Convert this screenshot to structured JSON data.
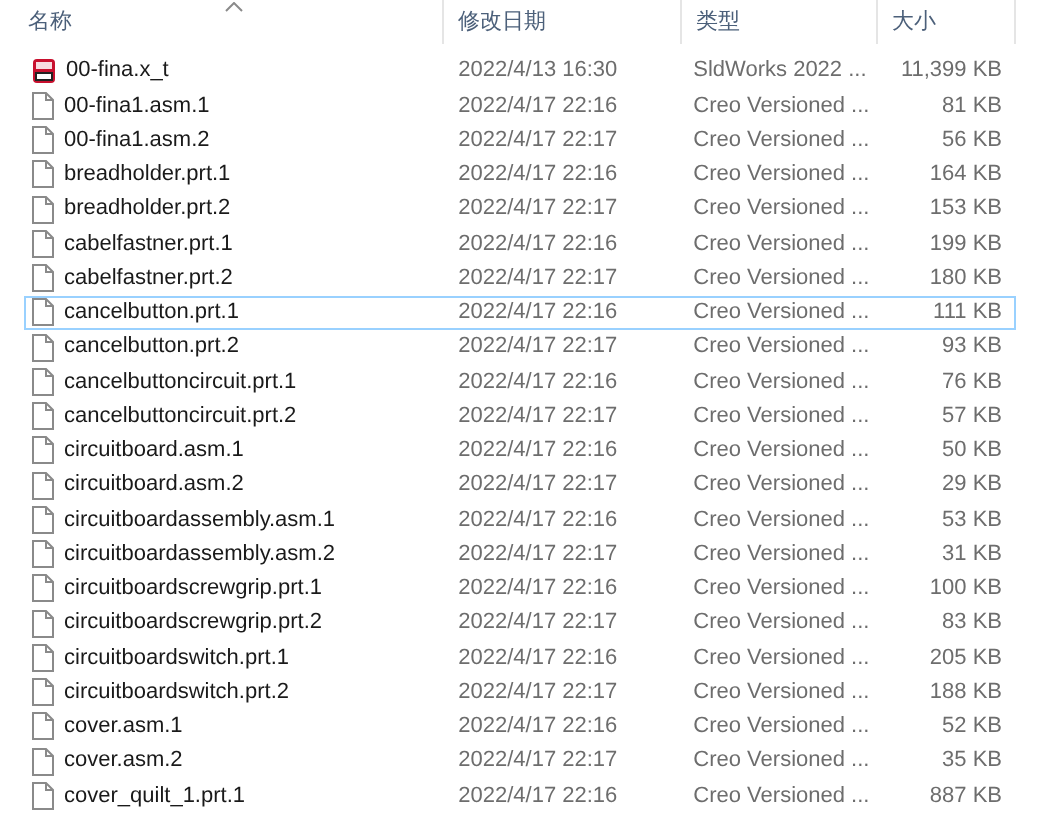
{
  "columns": [
    {
      "label": "名称",
      "sorted": true
    },
    {
      "label": "修改日期",
      "sorted": false
    },
    {
      "label": "类型",
      "sorted": false
    },
    {
      "label": "大小",
      "sorted": false
    }
  ],
  "rows": [
    {
      "kind": "solidworks",
      "name": "00-fina.x_t",
      "date": "2022/4/13 16:30",
      "type": "SldWorks 2022 ...",
      "size": "11,399 KB",
      "focused": false
    },
    {
      "kind": "file",
      "name": "00-fina1.asm.1",
      "date": "2022/4/17 22:16",
      "type": "Creo Versioned ...",
      "size": "81 KB",
      "focused": false
    },
    {
      "kind": "file",
      "name": "00-fina1.asm.2",
      "date": "2022/4/17 22:17",
      "type": "Creo Versioned ...",
      "size": "56 KB",
      "focused": false
    },
    {
      "kind": "file",
      "name": "breadholder.prt.1",
      "date": "2022/4/17 22:16",
      "type": "Creo Versioned ...",
      "size": "164 KB",
      "focused": false
    },
    {
      "kind": "file",
      "name": "breadholder.prt.2",
      "date": "2022/4/17 22:17",
      "type": "Creo Versioned ...",
      "size": "153 KB",
      "focused": false
    },
    {
      "kind": "file",
      "name": "cabelfastner.prt.1",
      "date": "2022/4/17 22:16",
      "type": "Creo Versioned ...",
      "size": "199 KB",
      "focused": false
    },
    {
      "kind": "file",
      "name": "cabelfastner.prt.2",
      "date": "2022/4/17 22:17",
      "type": "Creo Versioned ...",
      "size": "180 KB",
      "focused": false
    },
    {
      "kind": "file",
      "name": "cancelbutton.prt.1",
      "date": "2022/4/17 22:16",
      "type": "Creo Versioned ...",
      "size": "111 KB",
      "focused": true
    },
    {
      "kind": "file",
      "name": "cancelbutton.prt.2",
      "date": "2022/4/17 22:17",
      "type": "Creo Versioned ...",
      "size": "93 KB",
      "focused": false
    },
    {
      "kind": "file",
      "name": "cancelbuttoncircuit.prt.1",
      "date": "2022/4/17 22:16",
      "type": "Creo Versioned ...",
      "size": "76 KB",
      "focused": false
    },
    {
      "kind": "file",
      "name": "cancelbuttoncircuit.prt.2",
      "date": "2022/4/17 22:17",
      "type": "Creo Versioned ...",
      "size": "57 KB",
      "focused": false
    },
    {
      "kind": "file",
      "name": "circuitboard.asm.1",
      "date": "2022/4/17 22:16",
      "type": "Creo Versioned ...",
      "size": "50 KB",
      "focused": false
    },
    {
      "kind": "file",
      "name": "circuitboard.asm.2",
      "date": "2022/4/17 22:17",
      "type": "Creo Versioned ...",
      "size": "29 KB",
      "focused": false
    },
    {
      "kind": "file",
      "name": "circuitboardassembly.asm.1",
      "date": "2022/4/17 22:16",
      "type": "Creo Versioned ...",
      "size": "53 KB",
      "focused": false
    },
    {
      "kind": "file",
      "name": "circuitboardassembly.asm.2",
      "date": "2022/4/17 22:17",
      "type": "Creo Versioned ...",
      "size": "31 KB",
      "focused": false
    },
    {
      "kind": "file",
      "name": "circuitboardscrewgrip.prt.1",
      "date": "2022/4/17 22:16",
      "type": "Creo Versioned ...",
      "size": "100 KB",
      "focused": false
    },
    {
      "kind": "file",
      "name": "circuitboardscrewgrip.prt.2",
      "date": "2022/4/17 22:17",
      "type": "Creo Versioned ...",
      "size": "83 KB",
      "focused": false
    },
    {
      "kind": "file",
      "name": "circuitboardswitch.prt.1",
      "date": "2022/4/17 22:16",
      "type": "Creo Versioned ...",
      "size": "205 KB",
      "focused": false
    },
    {
      "kind": "file",
      "name": "circuitboardswitch.prt.2",
      "date": "2022/4/17 22:17",
      "type": "Creo Versioned ...",
      "size": "188 KB",
      "focused": false
    },
    {
      "kind": "file",
      "name": "cover.asm.1",
      "date": "2022/4/17 22:16",
      "type": "Creo Versioned ...",
      "size": "52 KB",
      "focused": false
    },
    {
      "kind": "file",
      "name": "cover.asm.2",
      "date": "2022/4/17 22:17",
      "type": "Creo Versioned ...",
      "size": "35 KB",
      "focused": false
    },
    {
      "kind": "file",
      "name": "cover_quilt_1.prt.1",
      "date": "2022/4/17 22:16",
      "type": "Creo Versioned ...",
      "size": "887 KB",
      "focused": false
    }
  ]
}
